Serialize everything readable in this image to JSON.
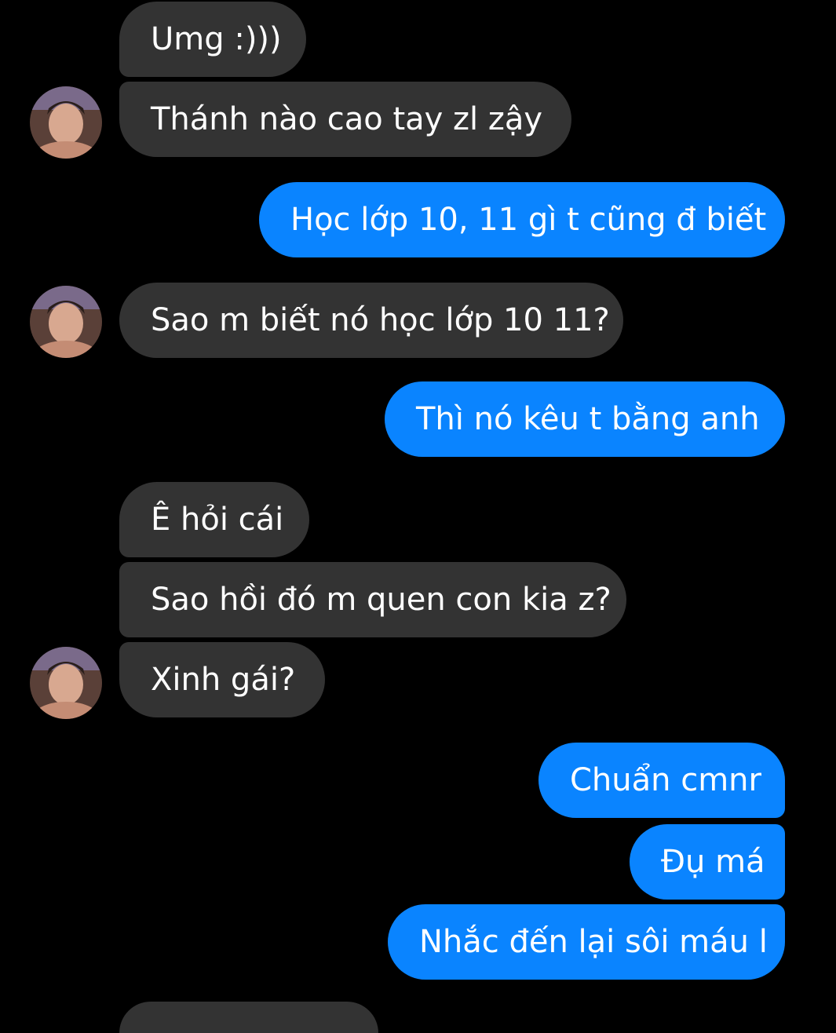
{
  "conversation": {
    "messages": [
      {
        "sender": "other",
        "text": "Umg :)))"
      },
      {
        "sender": "other",
        "text": "Thánh nào cao tay zl zậy"
      },
      {
        "sender": "me",
        "text": "Học lớp 10, 11 gì t cũng đ biết"
      },
      {
        "sender": "other",
        "text": "Sao m biết nó học lớp 10 11?"
      },
      {
        "sender": "me",
        "text": "Thì nó kêu t bằng anh"
      },
      {
        "sender": "other",
        "text": "Ê hỏi cái"
      },
      {
        "sender": "other",
        "text": "Sao hồi đó m quen con kia z?"
      },
      {
        "sender": "other",
        "text": "Xinh gái?"
      },
      {
        "sender": "me",
        "text": "Chuẩn cmnr"
      },
      {
        "sender": "me",
        "text": "Đụ má"
      },
      {
        "sender": "me",
        "text": "Nhắc đến lại sôi máu l"
      }
    ]
  },
  "theme": {
    "background": "#000000",
    "received_bubble": "#333333",
    "sent_bubble": "#0a84ff",
    "text": "#ffffff"
  }
}
